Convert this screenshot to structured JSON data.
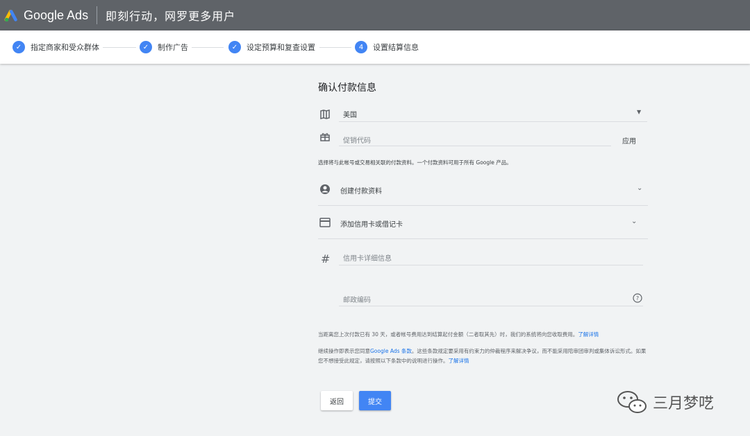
{
  "header": {
    "brand": "Google Ads",
    "title": "即刻行动，网罗更多用户"
  },
  "steps": [
    {
      "label": "指定商家和受众群体",
      "status": "done"
    },
    {
      "label": "制作广告",
      "status": "done"
    },
    {
      "label": "设定预算和复查设置",
      "status": "done"
    },
    {
      "label": "设置结算信息",
      "status": "current",
      "number": "4"
    }
  ],
  "form": {
    "heading": "确认付款信息",
    "country": "美国",
    "promo_placeholder": "促销代码",
    "apply_label": "应用",
    "profile_note": "选择将与此帐号或交易相关联的付款资料。一个付款资料可用于所有 Google 产品。",
    "create_profile_label": "创建付款资料",
    "add_card_label": "添加信用卡或借记卡",
    "card_details_placeholder": "信用卡详细信息",
    "postal_code_placeholder": "邮政编码",
    "billing_note": "当距离您上次付款已有 30 天，或者帐号费用达到结算起付金额（二者取其先）时，我们的系统将向您收取费用。",
    "billing_link": "了解详情",
    "terms_note_prefix": "继续操作即表示您同意",
    "terms_link_text": "Google Ads 条款",
    "terms_note_suffix": "。这些条款规定要采用有约束力的仲裁程序来解决争议，而不能采用陪审团审判或集体诉讼形式。如果您不想接受此规定，请按照以下条款中的说明进行操作。",
    "terms_link": "了解详情",
    "back_label": "返回",
    "submit_label": "提交"
  },
  "watermark": "三月梦呓",
  "icons": [
    "google-ads-logo",
    "check-icon",
    "map-icon",
    "gift-icon",
    "account-circle-icon",
    "credit-card-icon",
    "hash-icon",
    "help-icon",
    "chevron-down-icon",
    "wechat-icon"
  ],
  "colors": {
    "accent": "#4285f4",
    "topbar": "#5f6368",
    "link": "#1a73e8"
  }
}
